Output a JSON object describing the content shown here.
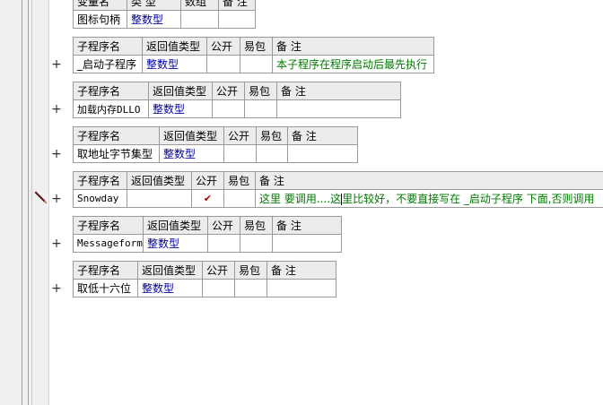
{
  "top_table": {
    "header": [
      "变量名",
      "类 型",
      "数组",
      "备 注"
    ],
    "row": {
      "name": "图标句柄",
      "type": "整数型",
      "array": "",
      "note": ""
    }
  },
  "sub_header": {
    "name": "子程序名",
    "return_type": "返回值类型",
    "public": "公开",
    "easy": "易包",
    "note": "备 注"
  },
  "expand_symbol": "+",
  "subroutines": [
    {
      "name": "_启动子程序",
      "return_type": "整数型",
      "public": "",
      "easy": "",
      "note": "本子程序在程序启动后最先执行"
    },
    {
      "name": "加载内存DLLO",
      "return_type": "整数型",
      "public": "",
      "easy": "",
      "note": ""
    },
    {
      "name": "取地址字节集型",
      "return_type": "整数型",
      "public": "",
      "easy": "",
      "note": ""
    },
    {
      "name": "Snowday",
      "return_type": "",
      "public": "✔",
      "easy": "",
      "note_before_caret": "这里 要调用....这",
      "note_after_caret": "里比较好，不要直接写在 _启动子程序 下面,否则调用"
    },
    {
      "name": "Messageform",
      "return_type": "整数型",
      "public": "",
      "easy": "",
      "note": ""
    },
    {
      "name": "取低十六位",
      "return_type": "整数型",
      "public": "",
      "easy": "",
      "note": ""
    }
  ],
  "icons": {
    "edit_marker": "pencil-icon",
    "expand": "plus-icon",
    "public_check": "check-icon"
  }
}
